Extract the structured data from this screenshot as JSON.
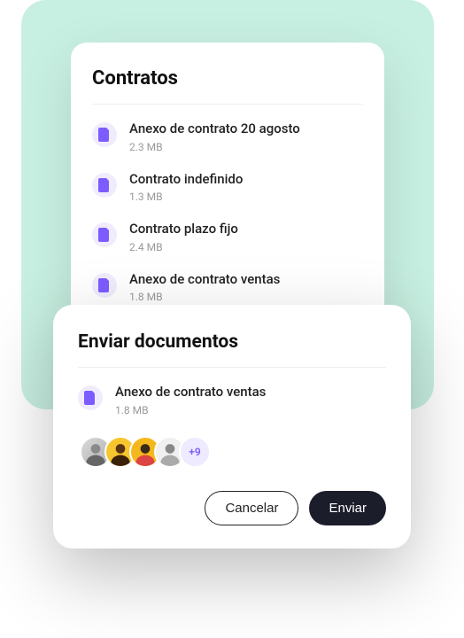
{
  "colors": {
    "mint": "#c8f0e2",
    "iconBg": "#f0ecfd",
    "iconFg": "#7c5cff",
    "btnDark": "#1b1d2a",
    "avatarMoreBg": "#eeeaff"
  },
  "contracts": {
    "title": "Contratos",
    "files": [
      {
        "name": "Anexo de contrato 20 agosto",
        "size": "2.3 MB"
      },
      {
        "name": "Contrato indefinido",
        "size": "1.3 MB"
      },
      {
        "name": "Contrato plazo fijo",
        "size": "2.4 MB"
      },
      {
        "name": "Anexo de contrato ventas",
        "size": "1.8 MB"
      }
    ]
  },
  "send": {
    "title": "Enviar documentos",
    "file": {
      "name": "Anexo de contrato ventas",
      "size": "1.8 MB"
    },
    "avatars_more": "+9",
    "cancel_label": "Cancelar",
    "send_label": "Enviar"
  }
}
